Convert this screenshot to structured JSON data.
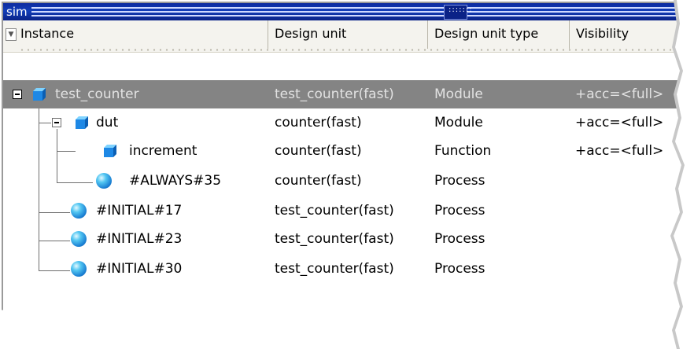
{
  "window": {
    "title": "sim"
  },
  "columns": {
    "instance": "Instance",
    "design_unit": "Design unit",
    "design_unit_type": "Design unit type",
    "visibility": "Visibility"
  },
  "rows": [
    {
      "instance": "test_counter",
      "design_unit": "test_counter(fast)",
      "design_unit_type": "Module",
      "visibility": "+acc=<full>",
      "icon": "module-icon",
      "expander": "collapse",
      "selected": true
    },
    {
      "instance": "dut",
      "design_unit": "counter(fast)",
      "design_unit_type": "Module",
      "visibility": "+acc=<full>",
      "icon": "module-icon",
      "expander": "collapse"
    },
    {
      "instance": "increment",
      "design_unit": "counter(fast)",
      "design_unit_type": "Function",
      "visibility": "+acc=<full>",
      "icon": "module-icon"
    },
    {
      "instance": "#ALWAYS#35",
      "design_unit": "counter(fast)",
      "design_unit_type": "Process",
      "visibility": "",
      "icon": "process-icon"
    },
    {
      "instance": "#INITIAL#17",
      "design_unit": "test_counter(fast)",
      "design_unit_type": "Process",
      "visibility": "",
      "icon": "process-icon"
    },
    {
      "instance": "#INITIAL#23",
      "design_unit": "test_counter(fast)",
      "design_unit_type": "Process",
      "visibility": "",
      "icon": "process-icon"
    },
    {
      "instance": "#INITIAL#30",
      "design_unit": "test_counter(fast)",
      "design_unit_type": "Process",
      "visibility": "",
      "icon": "process-icon"
    }
  ],
  "colors": {
    "titlebar": "#123db8",
    "selection": "#848484",
    "module_icon": "#1e88e5",
    "process_icon": "#2aa3e6"
  }
}
